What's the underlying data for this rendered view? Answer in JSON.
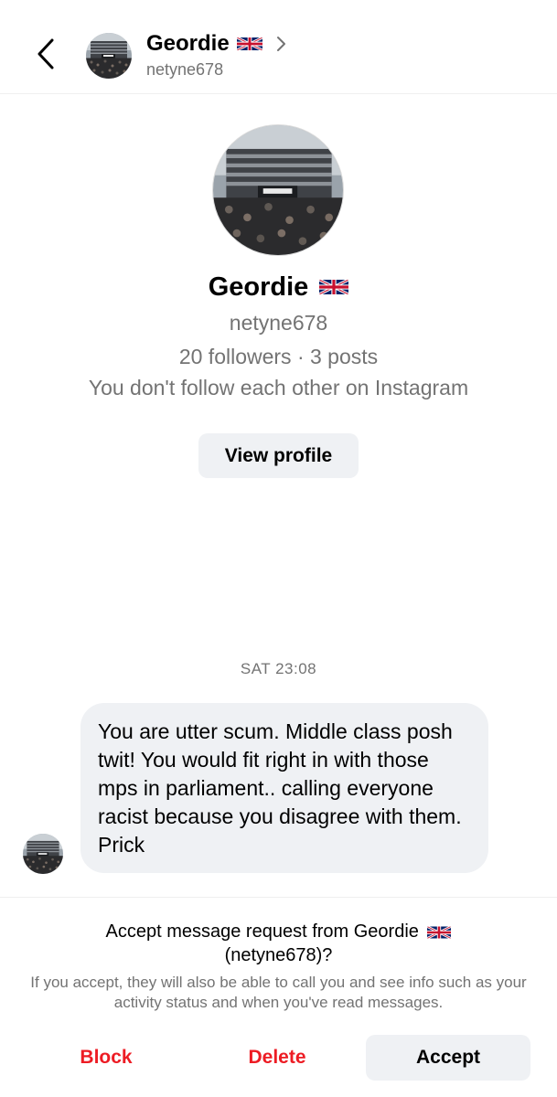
{
  "header": {
    "name": "Geordie",
    "username": "netyne678",
    "back_icon": "chevron-left-icon",
    "expand_icon": "chevron-right-icon"
  },
  "profile": {
    "name": "Geordie",
    "username": "netyne678",
    "stats": "20 followers · 3 posts",
    "follow_status": "You don't follow each other on Instagram",
    "view_profile_label": "View profile"
  },
  "conversation": {
    "timestamp": "SAT 23:08",
    "message": "You are utter scum. Middle class posh twit! You would fit right in with those mps in parliament.. calling everyone racist because you disagree with them. Prick"
  },
  "request": {
    "title_prefix": "Accept message request from Geordie",
    "title_suffix": "(netyne678)?",
    "description": "If you accept, they will also be able to call you and see info such as your activity status and when you've read messages.",
    "block_label": "Block",
    "delete_label": "Delete",
    "accept_label": "Accept"
  },
  "colors": {
    "destructive": "#ed1c24",
    "secondary_text": "#737373",
    "bubble": "#eff1f4"
  }
}
